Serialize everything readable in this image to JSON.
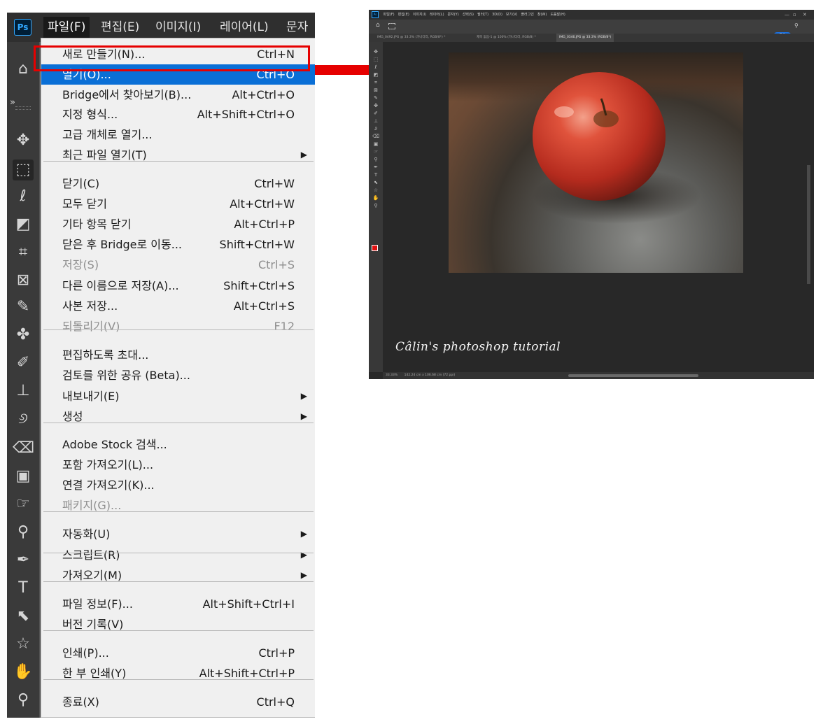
{
  "app": {
    "logo": "Ps"
  },
  "menubar": {
    "items": [
      {
        "label": "파일(F)"
      },
      {
        "label": "편집(E)"
      },
      {
        "label": "이미지(I)"
      },
      {
        "label": "레이어(L)"
      },
      {
        "label": "문자"
      }
    ]
  },
  "tools": [
    {
      "name": "home-icon",
      "glyph": "⌂"
    },
    {
      "name": "expand-icon",
      "glyph": "»"
    },
    {
      "name": "move-tool-icon",
      "glyph": "✥"
    },
    {
      "name": "marquee-tool-icon",
      "glyph": "⬚"
    },
    {
      "name": "lasso-tool-icon",
      "glyph": "ℓ"
    },
    {
      "name": "object-select-tool-icon",
      "glyph": "◩"
    },
    {
      "name": "crop-tool-icon",
      "glyph": "⌗"
    },
    {
      "name": "frame-tool-icon",
      "glyph": "⊠"
    },
    {
      "name": "eyedropper-tool-icon",
      "glyph": "✎"
    },
    {
      "name": "healing-brush-tool-icon",
      "glyph": "✤"
    },
    {
      "name": "brush-tool-icon",
      "glyph": "✐"
    },
    {
      "name": "stamp-tool-icon",
      "glyph": "⊥"
    },
    {
      "name": "history-brush-tool-icon",
      "glyph": "୬"
    },
    {
      "name": "eraser-tool-icon",
      "glyph": "⌫"
    },
    {
      "name": "gradient-tool-icon",
      "glyph": "▣"
    },
    {
      "name": "smudge-tool-icon",
      "glyph": "☞"
    },
    {
      "name": "dodge-tool-icon",
      "glyph": "⚲"
    },
    {
      "name": "pen-tool-icon",
      "glyph": "✒"
    },
    {
      "name": "type-tool-icon",
      "glyph": "T"
    },
    {
      "name": "path-select-tool-icon",
      "glyph": "⬉"
    },
    {
      "name": "shape-tool-icon",
      "glyph": "☆"
    },
    {
      "name": "hand-tool-icon",
      "glyph": "✋"
    },
    {
      "name": "zoom-tool-icon",
      "glyph": "⚲"
    }
  ],
  "file_menu": {
    "items": [
      {
        "label": "새로 만들기(N)...",
        "shortcut": "Ctrl+N"
      },
      {
        "label": "열기(O)...",
        "shortcut": "Ctrl+O"
      },
      {
        "label": "Bridge에서 찾아보기(B)...",
        "shortcut": "Alt+Ctrl+O"
      },
      {
        "label": "지정 형식...",
        "shortcut": "Alt+Shift+Ctrl+O"
      },
      {
        "label": "고급 개체로 열기...",
        "shortcut": ""
      },
      {
        "label": "최근 파일 열기(T)",
        "shortcut": ""
      },
      {
        "label": "닫기(C)",
        "shortcut": "Ctrl+W"
      },
      {
        "label": "모두 닫기",
        "shortcut": "Alt+Ctrl+W"
      },
      {
        "label": "기타 항목 닫기",
        "shortcut": "Alt+Ctrl+P"
      },
      {
        "label": "닫은 후 Bridge로 이동...",
        "shortcut": "Shift+Ctrl+W"
      },
      {
        "label": "저장(S)",
        "shortcut": "Ctrl+S"
      },
      {
        "label": "다른 이름으로 저장(A)...",
        "shortcut": "Shift+Ctrl+S"
      },
      {
        "label": "사본 저장...",
        "shortcut": "Alt+Ctrl+S"
      },
      {
        "label": "되돌리기(V)",
        "shortcut": "F12"
      },
      {
        "label": "편집하도록 초대...",
        "shortcut": ""
      },
      {
        "label": "검토를 위한 공유 (Beta)...",
        "shortcut": ""
      },
      {
        "label": "내보내기(E)",
        "shortcut": ""
      },
      {
        "label": "생성",
        "shortcut": ""
      },
      {
        "label": "Adobe Stock 검색...",
        "shortcut": ""
      },
      {
        "label": "포함 가져오기(L)...",
        "shortcut": ""
      },
      {
        "label": "연결 가져오기(K)...",
        "shortcut": ""
      },
      {
        "label": "패키지(G)...",
        "shortcut": ""
      },
      {
        "label": "자동화(U)",
        "shortcut": ""
      },
      {
        "label": "스크립트(R)",
        "shortcut": ""
      },
      {
        "label": "가져오기(M)",
        "shortcut": ""
      },
      {
        "label": "파일 정보(F)...",
        "shortcut": "Alt+Shift+Ctrl+I"
      },
      {
        "label": "버전 기록(V)",
        "shortcut": ""
      },
      {
        "label": "인쇄(P)...",
        "shortcut": "Ctrl+P"
      },
      {
        "label": "한 부 인쇄(Y)",
        "shortcut": "Alt+Shift+Ctrl+P"
      },
      {
        "label": "종료(X)",
        "shortcut": "Ctrl+Q"
      }
    ]
  },
  "preview": {
    "logo": "Ps",
    "menubar": [
      "파일(F)",
      "편집(E)",
      "이미지(I)",
      "레이어(L)",
      "문자(Y)",
      "선택(S)",
      "필터(T)",
      "3D(D)",
      "보기(V)",
      "플러그인",
      "창(W)",
      "도움말(H)"
    ],
    "tabs": [
      "IMG_0492.JPG @ 33.3% (가나다라, RGB/8*) *",
      "제목 없음-1 @ 100% (가나다라, RGB/8) *",
      "IMG_0346.JPG @ 33.3% (RGB/8*)"
    ],
    "share_label": "공유",
    "status_zoom": "33.33%",
    "status_size": "142.24 cm x 106.68 cm (72 ppi)",
    "watermark": "Câlin's photoshop tutorial"
  }
}
